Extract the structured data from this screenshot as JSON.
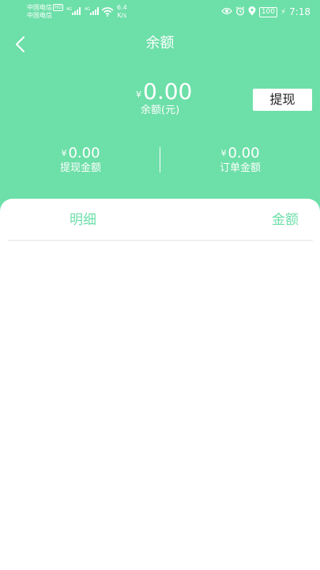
{
  "status_bar": {
    "carrier_1": "中国电信",
    "carrier_1_badge": "HD",
    "carrier_2": "中国电信",
    "speed_value": "6.4",
    "speed_unit": "K/s",
    "battery": "100",
    "time": "7:18",
    "icons": [
      "eye-icon",
      "alarm-icon",
      "location-icon",
      "battery-icon",
      "charging-icon",
      "wifi-icon",
      "signal-icon"
    ]
  },
  "header": {
    "title": "余额",
    "back_icon": "chevron-left-icon"
  },
  "balance": {
    "currency": "¥",
    "amount": "0.00",
    "label": "余额(元)",
    "withdraw_label": "提现"
  },
  "stats": {
    "withdrawn": {
      "currency": "¥",
      "value": "0.00",
      "label": "提现金额"
    },
    "orders": {
      "currency": "¥",
      "value": "0.00",
      "label": "订单金额"
    }
  },
  "list": {
    "col_detail": "明细",
    "col_amount": "金额",
    "rows": []
  },
  "colors": {
    "accent": "#6ddfa8",
    "background": "#ffffff"
  }
}
